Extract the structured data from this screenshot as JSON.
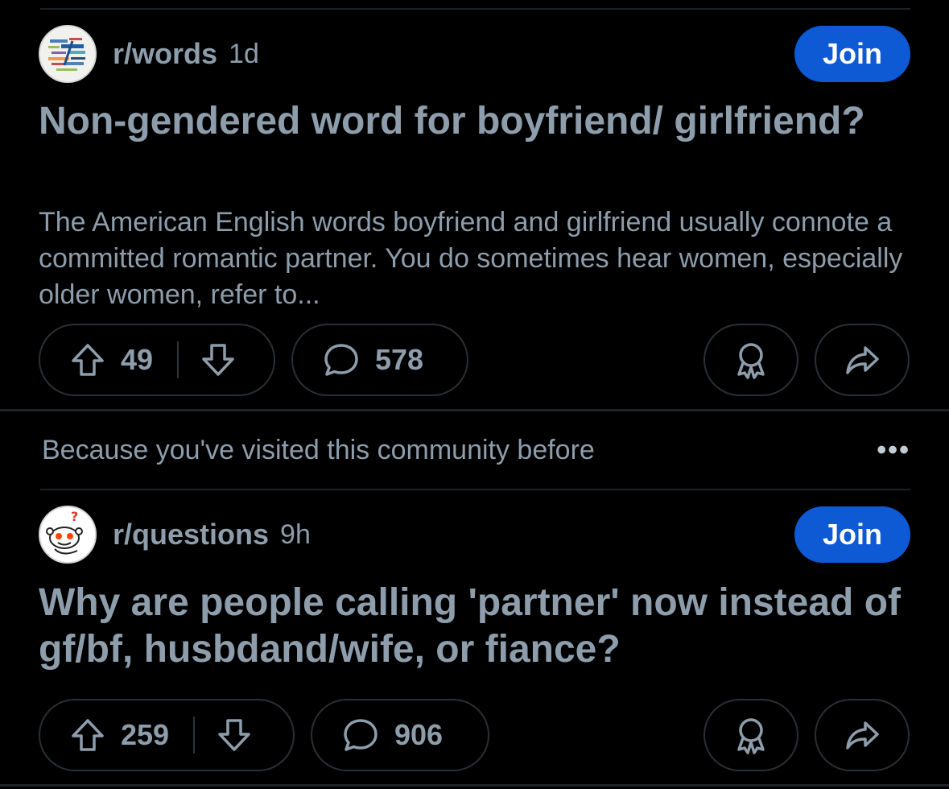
{
  "feed": {
    "post1": {
      "community": "r/words",
      "age": "1d",
      "join_label": "Join",
      "title": "Non-gendered word for boyfriend/ girlfriend?",
      "body": "The American English words boyfriend and girlfriend usually connote a committed romantic partner. You do sometimes hear women, especially older women, refer to...",
      "upvotes": "49",
      "comments": "578",
      "avatar_icon": "word-cloud-icon"
    },
    "recommendation": {
      "reason": "Because you've visited this community before",
      "more_icon": "more-options-icon"
    },
    "post2": {
      "community": "r/questions",
      "age": "9h",
      "join_label": "Join",
      "title": "Why are people calling 'partner' now instead of gf/bf, husbdand/wife, or fiance?",
      "upvotes": "259",
      "comments": "906",
      "avatar_icon": "snoo-question-icon"
    }
  },
  "colors": {
    "background": "#000000",
    "text": "#8d9dab",
    "join_button": "#0e59d4",
    "pill_border": "#2a2f34"
  },
  "icons": [
    "upvote-icon",
    "downvote-icon",
    "comment-icon",
    "award-icon",
    "share-icon"
  ]
}
